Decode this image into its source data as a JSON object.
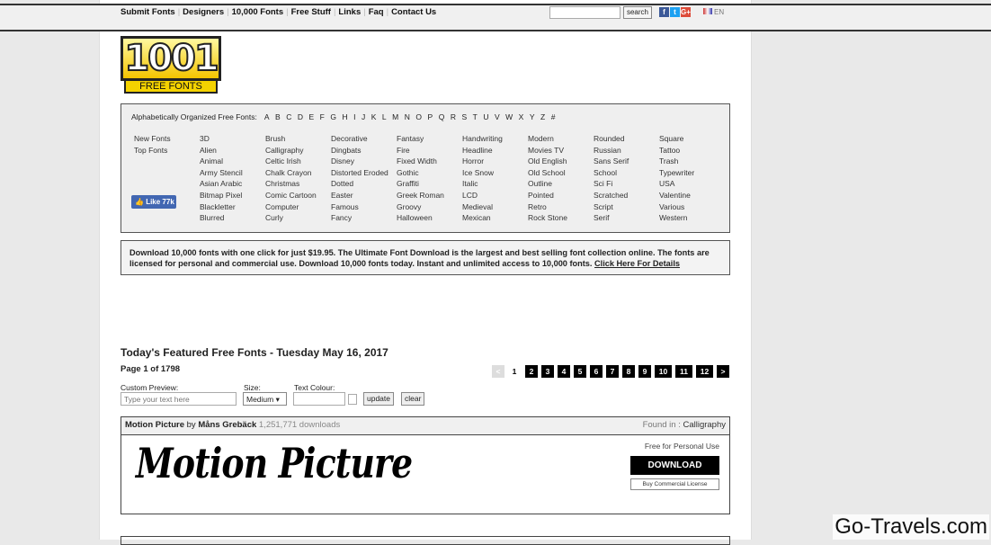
{
  "nav": {
    "items": [
      "Submit Fonts",
      "Designers",
      "10,000 Fonts",
      "Free Stuff",
      "Links",
      "Faq",
      "Contact Us"
    ],
    "search_button": "search",
    "language": "EN"
  },
  "social": [
    {
      "icon": "facebook-icon",
      "glyph": "f",
      "color": "#3b5998"
    },
    {
      "icon": "twitter-icon",
      "glyph": "t",
      "color": "#1da1f2"
    },
    {
      "icon": "google-plus-icon",
      "glyph": "G+",
      "color": "#dd4b39"
    }
  ],
  "logo": {
    "number": "1001",
    "text": "FREE FONTS"
  },
  "categories": {
    "alpha_label": "Alphabetically Organized Free Fonts:",
    "letters": [
      "A",
      "B",
      "C",
      "D",
      "E",
      "F",
      "G",
      "H",
      "I",
      "J",
      "K",
      "L",
      "M",
      "N",
      "O",
      "P",
      "Q",
      "R",
      "S",
      "T",
      "U",
      "V",
      "W",
      "X",
      "Y",
      "Z",
      "#"
    ],
    "columns": [
      [
        "New Fonts",
        "Top Fonts"
      ],
      [
        "3D",
        "Alien",
        "Animal",
        "Army Stencil",
        "Asian Arabic",
        "Bitmap Pixel",
        "Blackletter",
        "Blurred"
      ],
      [
        "Brush",
        "Calligraphy",
        "Celtic Irish",
        "Chalk Crayon",
        "Christmas",
        "Comic Cartoon",
        "Computer",
        "Curly"
      ],
      [
        "Decorative",
        "Dingbats",
        "Disney",
        "Distorted Eroded",
        "Dotted",
        "Easter",
        "Famous",
        "Fancy"
      ],
      [
        "Fantasy",
        "Fire",
        "Fixed Width",
        "Gothic",
        "Graffiti",
        "Greek Roman",
        "Groovy",
        "Halloween"
      ],
      [
        "Handwriting",
        "Headline",
        "Horror",
        "Ice Snow",
        "Italic",
        "LCD",
        "Medieval",
        "Mexican"
      ],
      [
        "Modern",
        "Movies TV",
        "Old English",
        "Old School",
        "Outline",
        "Pointed",
        "Retro",
        "Rock Stone"
      ],
      [
        "Rounded",
        "Russian",
        "Sans Serif",
        "School",
        "Sci Fi",
        "Scratched",
        "Script",
        "Serif"
      ],
      [
        "Square",
        "Tattoo",
        "Trash",
        "Typewriter",
        "USA",
        "Valentine",
        "Various",
        "Western"
      ]
    ],
    "like": "Like 77k"
  },
  "promo": {
    "text": "Download 10,000 fonts with one click for just $19.95. The Ultimate Font Download is the largest and best selling font collection online. The fonts are licensed for personal and commercial use. Download 10,000 fonts today. Instant and unlimited access to 10,000 fonts. ",
    "link": "Click Here For Details"
  },
  "featured": {
    "title": "Today's Featured Free Fonts - Tuesday May 16, 2017",
    "page_info": "Page 1 of 1798",
    "pager": {
      "prev": "<",
      "current": "1",
      "pages": [
        "2",
        "3",
        "4",
        "5",
        "6",
        "7",
        "8",
        "9",
        "10",
        "11",
        "12"
      ],
      "next": ">"
    },
    "custom_label": "Custom Preview:",
    "custom_placeholder": "Type your text here",
    "size_label": "Size:",
    "size_value": "Medium ▾",
    "colour_label": "Text Colour:",
    "update": "update",
    "clear": "clear"
  },
  "font": {
    "name": "Motion Picture",
    "by": "by",
    "author": "Måns Grebäck",
    "downloads": "1,251,771 downloads",
    "found_label": "Found in :",
    "found_value": "Calligraphy",
    "preview": "Motion Picture",
    "license": "Free for Personal Use",
    "download": "DOWNLOAD",
    "commercial": "Buy Commercial License"
  },
  "watermark": "Go-Travels.com"
}
